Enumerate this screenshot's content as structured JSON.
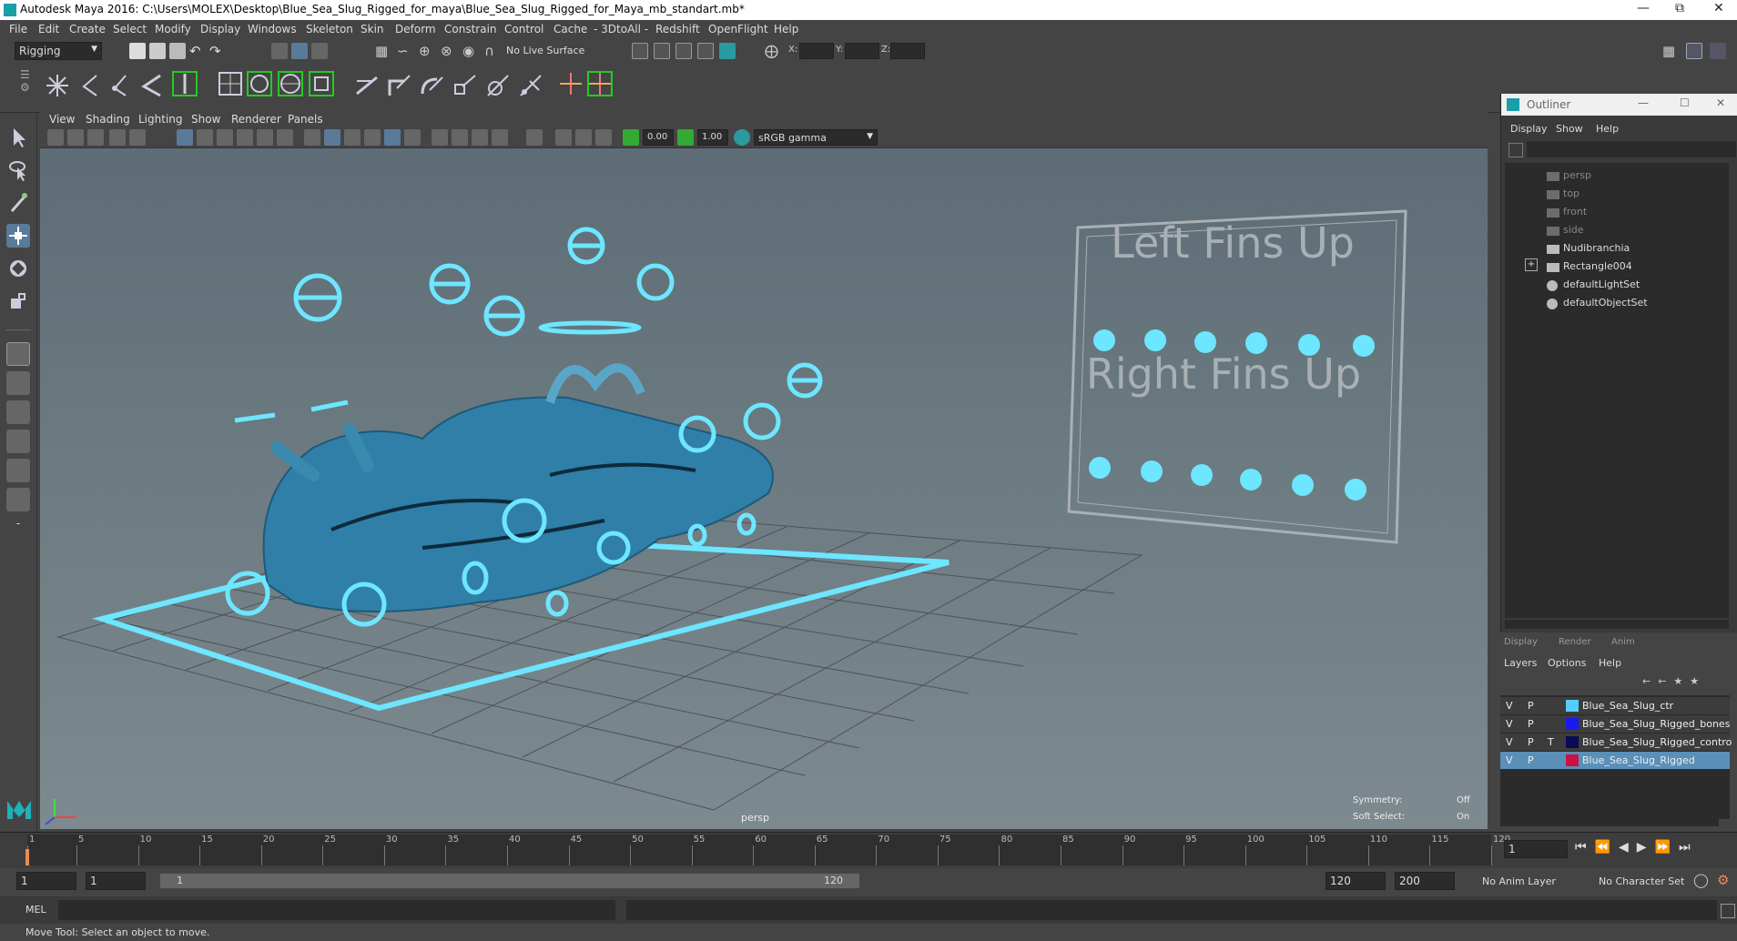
{
  "window": {
    "title": "Autodesk Maya 2016: C:\\Users\\MOLEX\\Desktop\\Blue_Sea_Slug_Rigged_for_maya\\Blue_Sea_Slug_Rigged_for_Maya_mb_standart.mb*"
  },
  "menu": [
    "File",
    "Edit",
    "Create",
    "Select",
    "Modify",
    "Display",
    "Windows",
    "Skeleton",
    "Skin",
    "Deform",
    "Constrain",
    "Control",
    "Cache",
    "- 3DtoAll -",
    "Redshift",
    "OpenFlight",
    "Help"
  ],
  "status": {
    "mode": "Rigging",
    "live_surface": "No Live Surface",
    "x_label": "X:",
    "y_label": "Y:",
    "z_label": "Z:"
  },
  "viewport": {
    "menu": [
      "View",
      "Shading",
      "Lighting",
      "Show",
      "Renderer",
      "Panels"
    ],
    "exposure": "0.00",
    "gamma": "1.00",
    "color_space": "sRGB gamma",
    "camera": "persp",
    "symmetry_label": "Symmetry:",
    "symmetry_value": "Off",
    "soft_select_label": "Soft Select:",
    "soft_select_value": "On",
    "panel_left_title": "Left Fins Up",
    "panel_right_title": "Right Fins Up"
  },
  "outliner": {
    "title": "Outliner",
    "menu": [
      "Display",
      "Show",
      "Help"
    ],
    "items": [
      "persp",
      "top",
      "front",
      "side",
      "Nudibranchia",
      "Rectangle004",
      "defaultLightSet",
      "defaultObjectSet"
    ]
  },
  "layers": {
    "tabs": [
      "Display",
      "Render",
      "Anim"
    ],
    "menu": [
      "Layers",
      "Options",
      "Help"
    ],
    "rows": [
      {
        "v": "V",
        "p": "P",
        "t": "",
        "name": "Blue_Sea_Slug_ctr",
        "color": "#55ccff"
      },
      {
        "v": "V",
        "p": "P",
        "t": "",
        "name": "Blue_Sea_Slug_Rigged_bones",
        "color": "#1a1aee"
      },
      {
        "v": "V",
        "p": "P",
        "t": "T",
        "name": "Blue_Sea_Slug_Rigged_contro",
        "color": "#0a0a55"
      },
      {
        "v": "V",
        "p": "P",
        "t": "",
        "name": "Blue_Sea_Slug_Rigged",
        "color": "#cc1144"
      }
    ]
  },
  "timeline": {
    "ticks": [
      "1",
      "5",
      "10",
      "15",
      "20",
      "25",
      "30",
      "35",
      "40",
      "45",
      "50",
      "55",
      "60",
      "65",
      "70",
      "75",
      "80",
      "85",
      "90",
      "95",
      "100",
      "105",
      "110",
      "115",
      "120"
    ],
    "current_frame": "1"
  },
  "range": {
    "start": "1",
    "current": "1",
    "range_start": "1",
    "range_end": "120",
    "end": "120",
    "max_end": "200",
    "anim_layer": "No Anim Layer",
    "character_set": "No Character Set"
  },
  "mel": {
    "label": "MEL"
  },
  "help": {
    "text": "Move Tool: Select an object to move."
  }
}
